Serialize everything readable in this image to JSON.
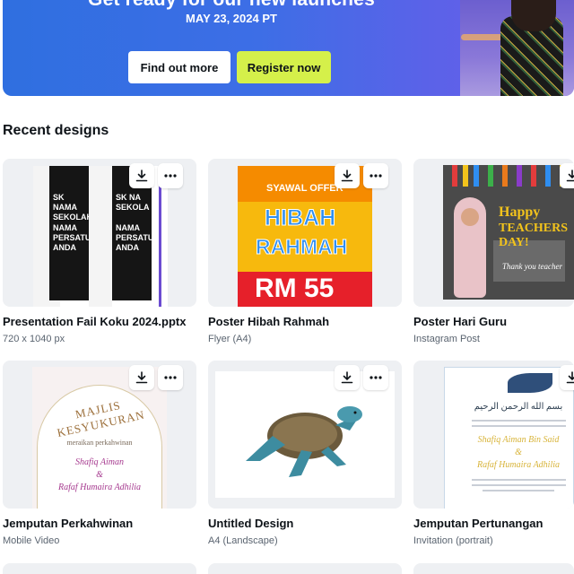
{
  "hero": {
    "headline": "Get ready for our new launches",
    "date": "MAY 23, 2024 PT",
    "find_out_more": "Find out more",
    "register_now": "Register now"
  },
  "section_title": "Recent designs",
  "designs": [
    {
      "title": "Presentation Fail Koku 2024.pptx",
      "subtitle": "720 x 1040 px",
      "preview": {
        "banner_text": "SK NAMA SEKOLAH",
        "banner_text2": "NAMA PERSATUAN ANDA",
        "banner_text_b": "SK NA SEKOLA",
        "banner_text2_b": "NAMA PERSATUAN ANDA"
      }
    },
    {
      "title": "Poster Hibah Rahmah",
      "subtitle": "Flyer (A4)",
      "preview": {
        "offer": "SYAWAL OFFER",
        "line1": "HIBAH",
        "line2": "RAHMAH",
        "price": "RM 55"
      }
    },
    {
      "title": "Poster Hari Guru",
      "subtitle": "Instagram Post",
      "preview": {
        "happy": "Happy",
        "day": "TEACHERS DAY!",
        "thanks": "Thank you teacher"
      }
    },
    {
      "title": "Jemputan Perkahwinan",
      "subtitle": "Mobile Video",
      "preview": {
        "heading": "MAJLIS KESYUKURAN",
        "sub": "meraikan perkahwinan",
        "name1": "Shafiq Aiman",
        "amp": "&",
        "name2": "Rafaf Humaira Adhilia"
      }
    },
    {
      "title": "Untitled Design",
      "subtitle": "A4 (Landscape)",
      "preview": {}
    },
    {
      "title": "Jemputan Pertunangan",
      "subtitle": "Invitation (portrait)",
      "preview": {
        "arabic": "بسم الله الرحمن الرحيم",
        "name1": "Shafiq Aiman Bin Said",
        "amp": "&",
        "name2": "Rafaf Humaira Adhilia"
      }
    }
  ],
  "icons": {
    "download": "download-icon",
    "more": "more-options-icon"
  },
  "colors": {
    "hero": "#3d6ee6",
    "register": "#d5f04a",
    "card_bg": "#eef0f3"
  }
}
